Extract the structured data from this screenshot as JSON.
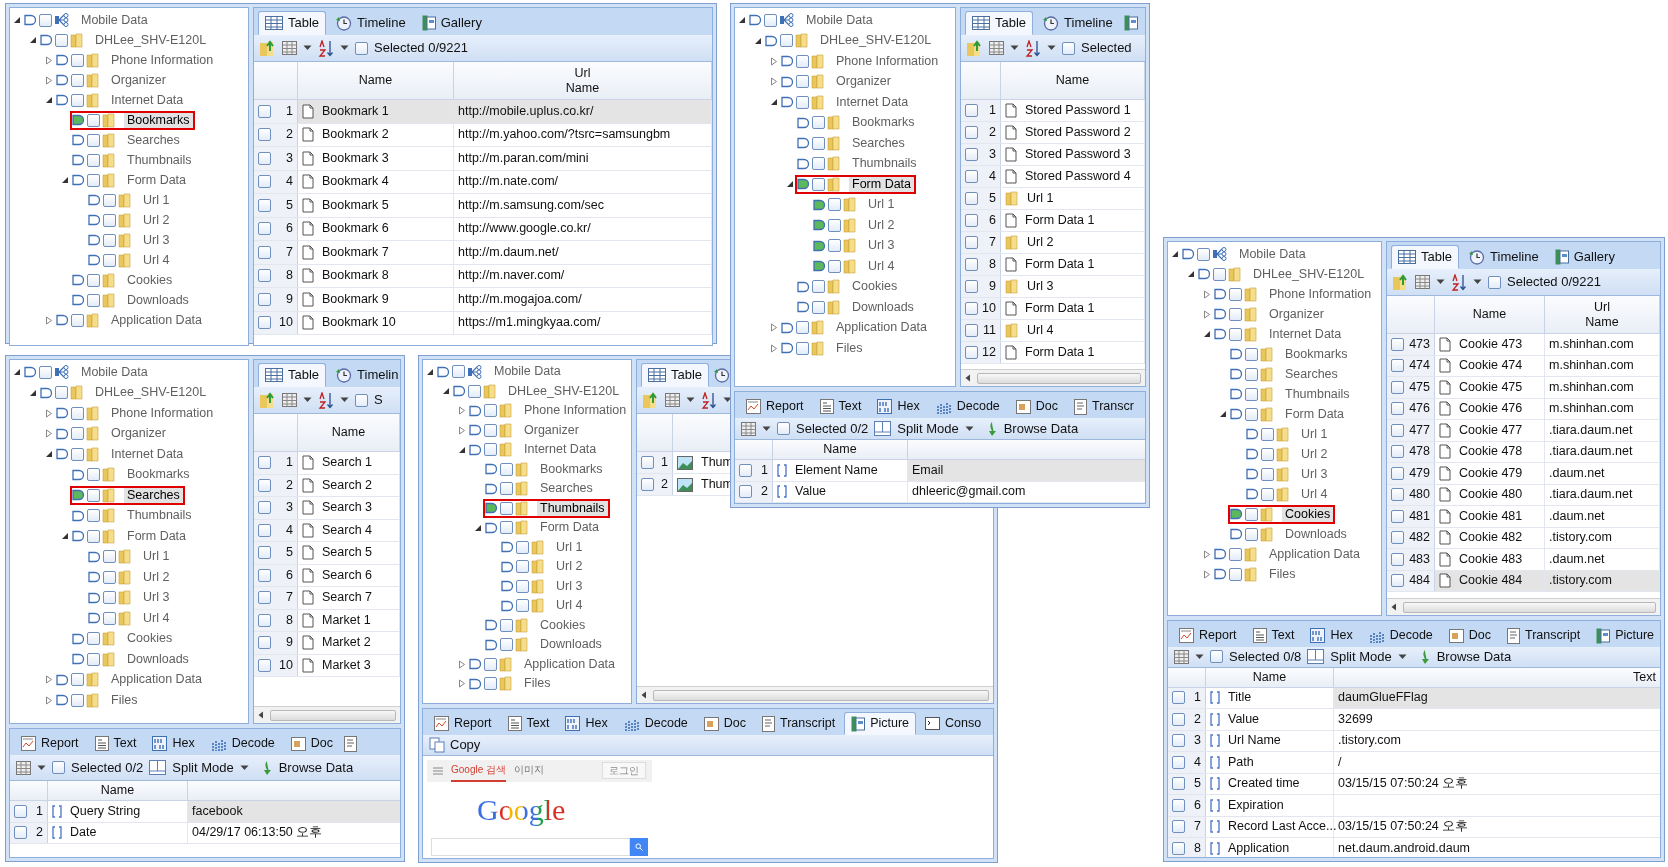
{
  "windows": [
    {
      "tree": [
        {
          "label": "Mobile Data",
          "expanded": true,
          "selected": false,
          "marked": false,
          "checked": false,
          "children": [
            {
              "label": "DHLee_SHV-E120L",
              "expanded": true,
              "selected": false,
              "marked": false,
              "checked": false,
              "children": [
                {
                  "label": "Phone Information",
                  "expanded": false,
                  "selected": false,
                  "marked": false,
                  "checked": false
                },
                {
                  "label": "Organizer",
                  "expanded": false,
                  "selected": false,
                  "marked": false,
                  "checked": false
                },
                {
                  "label": "Internet Data",
                  "expanded": true,
                  "selected": false,
                  "marked": false,
                  "checked": false,
                  "children": [
                    {
                      "label": "Bookmarks",
                      "selected": true,
                      "marked": true,
                      "checked": false
                    },
                    {
                      "label": "Searches",
                      "selected": false,
                      "marked": false,
                      "checked": false
                    },
                    {
                      "label": "Thumbnails",
                      "selected": false,
                      "marked": false,
                      "checked": false
                    },
                    {
                      "label": "Form Data",
                      "expanded": true,
                      "selected": false,
                      "marked": false,
                      "checked": false,
                      "children": [
                        {
                          "label": "Url 1",
                          "selected": false,
                          "marked": false,
                          "checked": false
                        },
                        {
                          "label": "Url 2",
                          "selected": false,
                          "marked": false,
                          "checked": false
                        },
                        {
                          "label": "Url 3",
                          "selected": false,
                          "marked": false,
                          "checked": false
                        },
                        {
                          "label": "Url 4",
                          "selected": false,
                          "marked": false,
                          "checked": false
                        }
                      ]
                    },
                    {
                      "label": "Cookies",
                      "selected": false,
                      "marked": false,
                      "checked": false
                    },
                    {
                      "label": "Downloads",
                      "selected": false,
                      "marked": false,
                      "checked": false
                    }
                  ]
                },
                {
                  "label": "Application Data",
                  "expanded": false,
                  "selected": false,
                  "marked": false,
                  "checked": false
                }
              ]
            }
          ]
        }
      ],
      "view_tabs": [
        {
          "label": "Table",
          "kind": "table",
          "selected": true
        },
        {
          "label": "Timeline",
          "kind": "timeline",
          "selected": false
        },
        {
          "label": "Gallery",
          "kind": "gallery",
          "selected": false
        }
      ],
      "toolbar": {
        "selection_count": "Selected 0/9221",
        "checked": false
      },
      "table": {
        "columns": [
          "Name",
          "Url Name"
        ],
        "rows": [
          {
            "number": "1",
            "kind": "doc",
            "cells": [
              "Bookmark 1",
              "http://mobile.uplus.co.kr/"
            ],
            "selected": true,
            "checked": false
          },
          {
            "number": "2",
            "kind": "doc",
            "cells": [
              "Bookmark 2",
              "http://m.yahoo.com/?tsrc=samsungbm"
            ],
            "selected": false,
            "checked": false
          },
          {
            "number": "3",
            "kind": "doc",
            "cells": [
              "Bookmark 3",
              "http://m.paran.com/mini"
            ],
            "selected": false,
            "checked": false
          },
          {
            "number": "4",
            "kind": "doc",
            "cells": [
              "Bookmark 4",
              "http://m.nate.com/"
            ],
            "selected": false,
            "checked": false
          },
          {
            "number": "5",
            "kind": "doc",
            "cells": [
              "Bookmark 5",
              "http://m.samsung.com/sec"
            ],
            "selected": false,
            "checked": false
          },
          {
            "number": "6",
            "kind": "doc",
            "cells": [
              "Bookmark 6",
              "http://www.google.co.kr/"
            ],
            "selected": false,
            "checked": false
          },
          {
            "number": "7",
            "kind": "doc",
            "cells": [
              "Bookmark 7",
              "http://m.daum.net/"
            ],
            "selected": false,
            "checked": false
          },
          {
            "number": "8",
            "kind": "doc",
            "cells": [
              "Bookmark 8",
              "http://m.naver.com/"
            ],
            "selected": false,
            "checked": false
          },
          {
            "number": "9",
            "kind": "doc",
            "cells": [
              "Bookmark 9",
              "http://m.mogajoa.com/"
            ],
            "selected": false,
            "checked": false
          },
          {
            "number": "10",
            "kind": "doc",
            "cells": [
              "Bookmark 10",
              "https://m1.mingkyaa.com/"
            ],
            "selected": false,
            "checked": false
          }
        ]
      }
    },
    {
      "tree": [
        {
          "label": "Mobile Data",
          "expanded": true,
          "selected": false,
          "marked": false,
          "checked": false,
          "children": [
            {
              "label": "DHLee_SHV-E120L",
              "expanded": true,
              "selected": false,
              "marked": false,
              "checked": false,
              "children": [
                {
                  "label": "Phone Information",
                  "expanded": false,
                  "selected": false,
                  "marked": false,
                  "checked": false
                },
                {
                  "label": "Organizer",
                  "expanded": false,
                  "selected": false,
                  "marked": false,
                  "checked": false
                },
                {
                  "label": "Internet Data",
                  "expanded": true,
                  "selected": false,
                  "marked": false,
                  "checked": false,
                  "children": [
                    {
                      "label": "Bookmarks",
                      "selected": false,
                      "marked": false,
                      "checked": false
                    },
                    {
                      "label": "Searches",
                      "selected": true,
                      "marked": true,
                      "checked": false
                    },
                    {
                      "label": "Thumbnails",
                      "selected": false,
                      "marked": false,
                      "checked": false
                    },
                    {
                      "label": "Form Data",
                      "expanded": true,
                      "selected": false,
                      "marked": false,
                      "checked": false,
                      "children": [
                        {
                          "label": "Url 1",
                          "selected": false,
                          "marked": false,
                          "checked": false
                        },
                        {
                          "label": "Url 2",
                          "selected": false,
                          "marked": false,
                          "checked": false
                        },
                        {
                          "label": "Url 3",
                          "selected": false,
                          "marked": false,
                          "checked": false
                        },
                        {
                          "label": "Url 4",
                          "selected": false,
                          "marked": false,
                          "checked": false
                        }
                      ]
                    },
                    {
                      "label": "Cookies",
                      "selected": false,
                      "marked": false,
                      "checked": false
                    },
                    {
                      "label": "Downloads",
                      "selected": false,
                      "marked": false,
                      "checked": false
                    }
                  ]
                },
                {
                  "label": "Application Data",
                  "expanded": false,
                  "selected": false,
                  "marked": false,
                  "checked": false
                },
                {
                  "label": "Files",
                  "expanded": false,
                  "selected": false,
                  "marked": false,
                  "checked": false
                }
              ]
            }
          ]
        }
      ],
      "view_tabs": [
        {
          "label": "Table",
          "kind": "table",
          "selected": true
        },
        {
          "label": "Timelin",
          "kind": "timeline",
          "selected": false
        }
      ],
      "toolbar": {
        "selection_count": "S",
        "checked": false
      },
      "table": {
        "columns": [
          "Name"
        ],
        "rows": [
          {
            "number": "1",
            "kind": "doc",
            "cells": [
              "Search 1"
            ],
            "selected": false,
            "checked": false
          },
          {
            "number": "2",
            "kind": "doc",
            "cells": [
              "Search 2"
            ],
            "selected": false,
            "checked": false
          },
          {
            "number": "3",
            "kind": "doc",
            "cells": [
              "Search 3"
            ],
            "selected": false,
            "checked": false
          },
          {
            "number": "4",
            "kind": "doc",
            "cells": [
              "Search 4"
            ],
            "selected": false,
            "checked": false
          },
          {
            "number": "5",
            "kind": "doc",
            "cells": [
              "Search 5"
            ],
            "selected": false,
            "checked": false
          },
          {
            "number": "6",
            "kind": "doc",
            "cells": [
              "Search 6"
            ],
            "selected": false,
            "checked": false
          },
          {
            "number": "7",
            "kind": "doc",
            "cells": [
              "Search 7"
            ],
            "selected": false,
            "checked": false
          },
          {
            "number": "8",
            "kind": "doc",
            "cells": [
              "Market 1"
            ],
            "selected": false,
            "checked": false
          },
          {
            "number": "9",
            "kind": "doc",
            "cells": [
              "Market 2"
            ],
            "selected": false,
            "checked": false
          },
          {
            "number": "10",
            "kind": "doc",
            "cells": [
              "Market 3"
            ],
            "selected": false,
            "checked": false
          }
        ]
      },
      "detail": {
        "tabs": [
          {
            "label": "Report",
            "kind": "report",
            "selected": false
          },
          {
            "label": "Text",
            "kind": "text",
            "selected": false
          },
          {
            "label": "Hex",
            "kind": "hex",
            "selected": false
          },
          {
            "label": "Decode",
            "kind": "decode",
            "selected": false
          },
          {
            "label": "Doc",
            "kind": "doc",
            "selected": false
          },
          {
            "kind": "transcript",
            "selected": false
          }
        ],
        "toolbar": {
          "selection_count": "Selected 0/2",
          "checked": false,
          "split": "Split Mode",
          "browse": "Browse Data"
        },
        "columns": [
          "Name"
        ],
        "rows": [
          {
            "number": "1",
            "name": "Query String",
            "value": "facebook",
            "selected": true,
            "checked": false
          },
          {
            "number": "2",
            "name": "Date",
            "value": "04/29/17 06:13:50 오후",
            "selected": false,
            "checked": false
          }
        ]
      }
    },
    {
      "tree": [
        {
          "label": "Mobile Data",
          "expanded": true,
          "selected": false,
          "marked": false,
          "checked": false,
          "children": [
            {
              "label": "DHLee_SHV-E120L",
              "expanded": true,
              "selected": false,
              "marked": false,
              "checked": false,
              "children": [
                {
                  "label": "Phone Information",
                  "expanded": false,
                  "selected": false,
                  "marked": false,
                  "checked": false
                },
                {
                  "label": "Organizer",
                  "expanded": false,
                  "selected": false,
                  "marked": false,
                  "checked": false
                },
                {
                  "label": "Internet Data",
                  "expanded": true,
                  "selected": false,
                  "marked": false,
                  "checked": false,
                  "children": [
                    {
                      "label": "Bookmarks",
                      "selected": false,
                      "marked": false,
                      "checked": false
                    },
                    {
                      "label": "Searches",
                      "selected": false,
                      "marked": false,
                      "checked": false
                    },
                    {
                      "label": "Thumbnails",
                      "selected": true,
                      "marked": true,
                      "checked": false
                    },
                    {
                      "label": "Form Data",
                      "expanded": true,
                      "selected": false,
                      "marked": false,
                      "checked": false,
                      "children": [
                        {
                          "label": "Url 1",
                          "selected": false,
                          "marked": false,
                          "checked": false
                        },
                        {
                          "label": "Url 2",
                          "selected": false,
                          "marked": false,
                          "checked": false
                        },
                        {
                          "label": "Url 3",
                          "selected": false,
                          "marked": false,
                          "checked": false
                        },
                        {
                          "label": "Url 4",
                          "selected": false,
                          "marked": false,
                          "checked": false
                        }
                      ]
                    },
                    {
                      "label": "Cookies",
                      "selected": false,
                      "marked": false,
                      "checked": false
                    },
                    {
                      "label": "Downloads",
                      "selected": false,
                      "marked": false,
                      "checked": false
                    }
                  ]
                },
                {
                  "label": "Application Data",
                  "expanded": false,
                  "selected": false,
                  "marked": false,
                  "checked": false
                },
                {
                  "label": "Files",
                  "expanded": false,
                  "selected": false,
                  "marked": false,
                  "checked": false
                }
              ]
            }
          ]
        }
      ],
      "view_tabs": [
        {
          "label": "Table",
          "kind": "table",
          "selected": true
        },
        {
          "kind": "timeline",
          "selected": false
        }
      ],
      "table": {
        "rows": [
          {
            "number": "1",
            "kind": "image",
            "cells": [
              "Thum"
            ],
            "selected": false,
            "checked": false
          },
          {
            "number": "2",
            "kind": "image",
            "cells": [
              "Thum"
            ],
            "selected": false,
            "checked": false
          }
        ]
      },
      "detail": {
        "tabs": [
          {
            "label": "Report",
            "kind": "report",
            "selected": false
          },
          {
            "label": "Text",
            "kind": "text",
            "selected": false
          },
          {
            "label": "Hex",
            "kind": "hex",
            "selected": false
          },
          {
            "label": "Decode",
            "kind": "decode",
            "selected": false
          },
          {
            "label": "Doc",
            "kind": "doc",
            "selected": false
          },
          {
            "label": "Transcript",
            "kind": "transcript",
            "selected": false
          },
          {
            "label": "Picture",
            "kind": "picture",
            "selected": true
          },
          {
            "label": "Conso",
            "kind": "console",
            "selected": false
          }
        ],
        "copy": "Copy",
        "thumbnail": {
          "tabs": [
            {
              "label": "Google 검색",
              "selected": true
            },
            {
              "label": "이미지",
              "selected": false
            }
          ],
          "login": "로그인",
          "logo": "Google"
        }
      }
    },
    {
      "tree": [
        {
          "label": "Mobile Data",
          "expanded": true,
          "selected": false,
          "marked": false,
          "checked": false,
          "children": [
            {
              "label": "DHLee_SHV-E120L",
              "expanded": true,
              "selected": false,
              "marked": false,
              "checked": false,
              "children": [
                {
                  "label": "Phone Information",
                  "expanded": false,
                  "selected": false,
                  "marked": false,
                  "checked": false
                },
                {
                  "label": "Organizer",
                  "expanded": false,
                  "selected": false,
                  "marked": false,
                  "checked": false
                },
                {
                  "label": "Internet Data",
                  "expanded": true,
                  "selected": false,
                  "marked": false,
                  "checked": false,
                  "children": [
                    {
                      "label": "Bookmarks",
                      "selected": false,
                      "marked": false,
                      "checked": false
                    },
                    {
                      "label": "Searches",
                      "selected": false,
                      "marked": false,
                      "checked": false
                    },
                    {
                      "label": "Thumbnails",
                      "selected": false,
                      "marked": false,
                      "checked": false
                    },
                    {
                      "label": "Form Data",
                      "expanded": true,
                      "selected": true,
                      "marked": true,
                      "checked": false,
                      "children": [
                        {
                          "label": "Url 1",
                          "selected": false,
                          "marked": true,
                          "checked": false
                        },
                        {
                          "label": "Url 2",
                          "selected": false,
                          "marked": true,
                          "checked": false
                        },
                        {
                          "label": "Url 3",
                          "selected": false,
                          "marked": true,
                          "checked": false
                        },
                        {
                          "label": "Url 4",
                          "selected": false,
                          "marked": true,
                          "checked": false
                        }
                      ]
                    },
                    {
                      "label": "Cookies",
                      "selected": false,
                      "marked": false,
                      "checked": false
                    },
                    {
                      "label": "Downloads",
                      "selected": false,
                      "marked": false,
                      "checked": false
                    }
                  ]
                },
                {
                  "label": "Application Data",
                  "expanded": false,
                  "selected": false,
                  "marked": false,
                  "checked": false
                },
                {
                  "label": "Files",
                  "expanded": false,
                  "selected": false,
                  "marked": false,
                  "checked": false
                }
              ]
            }
          ]
        }
      ],
      "view_tabs": [
        {
          "label": "Table",
          "kind": "table",
          "selected": true
        },
        {
          "label": "Timeline",
          "kind": "timeline",
          "selected": false
        },
        {
          "kind": "gallery",
          "selected": false
        }
      ],
      "toolbar": {
        "selection_count": "Selected",
        "checked": false
      },
      "table": {
        "columns": [
          "Name"
        ],
        "rows": [
          {
            "number": "1",
            "kind": "doc",
            "cells": [
              "Stored Password 1"
            ],
            "selected": false,
            "checked": false
          },
          {
            "number": "2",
            "kind": "doc",
            "cells": [
              "Stored Password 2"
            ],
            "selected": false,
            "checked": false
          },
          {
            "number": "3",
            "kind": "doc",
            "cells": [
              "Stored Password 3"
            ],
            "selected": false,
            "checked": false
          },
          {
            "number": "4",
            "kind": "doc",
            "cells": [
              "Stored Password 4"
            ],
            "selected": false,
            "checked": false
          },
          {
            "number": "5",
            "kind": "folder",
            "cells": [
              "Url 1"
            ],
            "selected": false,
            "checked": false
          },
          {
            "number": "6",
            "kind": "doc",
            "cells": [
              "Form Data 1"
            ],
            "selected": false,
            "checked": false
          },
          {
            "number": "7",
            "kind": "folder",
            "cells": [
              "Url 2"
            ],
            "selected": false,
            "checked": false
          },
          {
            "number": "8",
            "kind": "doc",
            "cells": [
              "Form Data 1"
            ],
            "selected": false,
            "checked": false
          },
          {
            "number": "9",
            "kind": "folder",
            "cells": [
              "Url 3"
            ],
            "selected": false,
            "checked": false
          },
          {
            "number": "10",
            "kind": "doc",
            "cells": [
              "Form Data 1"
            ],
            "selected": false,
            "checked": false
          },
          {
            "number": "11",
            "kind": "folder",
            "cells": [
              "Url 4"
            ],
            "selected": false,
            "checked": false
          },
          {
            "number": "12",
            "kind": "doc",
            "cells": [
              "Form Data 1"
            ],
            "selected": false,
            "checked": false
          }
        ]
      },
      "detail": {
        "tabs": [
          {
            "label": "Report",
            "kind": "report",
            "selected": false
          },
          {
            "label": "Text",
            "kind": "text",
            "selected": false
          },
          {
            "label": "Hex",
            "kind": "hex",
            "selected": false
          },
          {
            "label": "Decode",
            "kind": "decode",
            "selected": false
          },
          {
            "label": "Doc",
            "kind": "doc",
            "selected": false
          },
          {
            "label": "Transcr",
            "kind": "transcript",
            "selected": false
          }
        ],
        "toolbar": {
          "selection_count": "Selected 0/2",
          "checked": false,
          "split": "Split Mode",
          "browse": "Browse Data"
        },
        "columns": [
          "Name"
        ],
        "rows": [
          {
            "number": "1",
            "name": "Element Name",
            "value": "Email",
            "selected": true,
            "checked": false
          },
          {
            "number": "2",
            "name": "Value",
            "value": "dhleeric@gmail.com",
            "selected": false,
            "checked": false
          }
        ]
      }
    },
    {
      "tree": [
        {
          "label": "Mobile Data",
          "expanded": true,
          "selected": false,
          "marked": false,
          "checked": false,
          "children": [
            {
              "label": "DHLee_SHV-E120L",
              "expanded": true,
              "selected": false,
              "marked": false,
              "checked": false,
              "children": [
                {
                  "label": "Phone Information",
                  "expanded": false,
                  "selected": false,
                  "marked": false,
                  "checked": false
                },
                {
                  "label": "Organizer",
                  "expanded": false,
                  "selected": false,
                  "marked": false,
                  "checked": false
                },
                {
                  "label": "Internet Data",
                  "expanded": true,
                  "selected": false,
                  "marked": false,
                  "checked": false,
                  "children": [
                    {
                      "label": "Bookmarks",
                      "selected": false,
                      "marked": false,
                      "checked": false
                    },
                    {
                      "label": "Searches",
                      "selected": false,
                      "marked": false,
                      "checked": false
                    },
                    {
                      "label": "Thumbnails",
                      "selected": false,
                      "marked": false,
                      "checked": false
                    },
                    {
                      "label": "Form Data",
                      "expanded": true,
                      "selected": false,
                      "marked": false,
                      "checked": false,
                      "children": [
                        {
                          "label": "Url 1",
                          "selected": false,
                          "marked": false,
                          "checked": false
                        },
                        {
                          "label": "Url 2",
                          "selected": false,
                          "marked": false,
                          "checked": false
                        },
                        {
                          "label": "Url 3",
                          "selected": false,
                          "marked": false,
                          "checked": false
                        },
                        {
                          "label": "Url 4",
                          "selected": false,
                          "marked": false,
                          "checked": false
                        }
                      ]
                    },
                    {
                      "label": "Cookies",
                      "selected": true,
                      "marked": true,
                      "checked": false
                    },
                    {
                      "label": "Downloads",
                      "selected": false,
                      "marked": false,
                      "checked": false
                    }
                  ]
                },
                {
                  "label": "Application Data",
                  "expanded": false,
                  "selected": false,
                  "marked": false,
                  "checked": false
                },
                {
                  "label": "Files",
                  "expanded": false,
                  "selected": false,
                  "marked": false,
                  "checked": false
                }
              ]
            }
          ]
        }
      ],
      "view_tabs": [
        {
          "label": "Table",
          "kind": "table",
          "selected": true
        },
        {
          "label": "Timeline",
          "kind": "timeline",
          "selected": false
        },
        {
          "label": "Gallery",
          "kind": "gallery",
          "selected": false
        }
      ],
      "toolbar": {
        "selection_count": "Selected 0/9221",
        "checked": false
      },
      "table": {
        "columns": [
          "Name",
          "Url Name"
        ],
        "rows": [
          {
            "number": "473",
            "kind": "doc",
            "cells": [
              "Cookie 473",
              "m.shinhan.com"
            ],
            "selected": false,
            "checked": false
          },
          {
            "number": "474",
            "kind": "doc",
            "cells": [
              "Cookie 474",
              "m.shinhan.com"
            ],
            "selected": false,
            "checked": false
          },
          {
            "number": "475",
            "kind": "doc",
            "cells": [
              "Cookie 475",
              "m.shinhan.com"
            ],
            "selected": false,
            "checked": false
          },
          {
            "number": "476",
            "kind": "doc",
            "cells": [
              "Cookie 476",
              "m.shinhan.com"
            ],
            "selected": false,
            "checked": false
          },
          {
            "number": "477",
            "kind": "doc",
            "cells": [
              "Cookie 477",
              ".tiara.daum.net"
            ],
            "selected": false,
            "checked": false
          },
          {
            "number": "478",
            "kind": "doc",
            "cells": [
              "Cookie 478",
              ".tiara.daum.net"
            ],
            "selected": false,
            "checked": false
          },
          {
            "number": "479",
            "kind": "doc",
            "cells": [
              "Cookie 479",
              ".daum.net"
            ],
            "selected": false,
            "checked": false
          },
          {
            "number": "480",
            "kind": "doc",
            "cells": [
              "Cookie 480",
              ".tiara.daum.net"
            ],
            "selected": false,
            "checked": false
          },
          {
            "number": "481",
            "kind": "doc",
            "cells": [
              "Cookie 481",
              ".daum.net"
            ],
            "selected": false,
            "checked": false
          },
          {
            "number": "482",
            "kind": "doc",
            "cells": [
              "Cookie 482",
              ".tistory.com"
            ],
            "selected": false,
            "checked": false
          },
          {
            "number": "483",
            "kind": "doc",
            "cells": [
              "Cookie 483",
              ".daum.net"
            ],
            "selected": false,
            "checked": false
          },
          {
            "number": "484",
            "kind": "doc",
            "cells": [
              "Cookie 484",
              ".tistory.com"
            ],
            "selected": true,
            "checked": false
          }
        ]
      },
      "detail": {
        "tabs": [
          {
            "label": "Report",
            "kind": "report",
            "selected": false
          },
          {
            "label": "Text",
            "kind": "text",
            "selected": false
          },
          {
            "label": "Hex",
            "kind": "hex",
            "selected": false
          },
          {
            "label": "Decode",
            "kind": "decode",
            "selected": false
          },
          {
            "label": "Doc",
            "kind": "doc",
            "selected": false
          },
          {
            "label": "Transcript",
            "kind": "transcript",
            "selected": false
          },
          {
            "label": "Picture",
            "kind": "picture",
            "selected": false
          }
        ],
        "toolbar": {
          "selection_count": "Selected 0/8",
          "checked": false,
          "split": "Split Mode",
          "browse": "Browse Data"
        },
        "columns": [
          "Name",
          "Text"
        ],
        "rows": [
          {
            "number": "1",
            "name": "Title",
            "value": "daumGlueFFlag",
            "selected": true,
            "checked": false
          },
          {
            "number": "2",
            "name": "Value",
            "value": "32699",
            "selected": false,
            "checked": false
          },
          {
            "number": "3",
            "name": "Url Name",
            "value": ".tistory.com",
            "selected": false,
            "checked": false
          },
          {
            "number": "4",
            "name": "Path",
            "value": "/",
            "selected": false,
            "checked": false
          },
          {
            "number": "5",
            "name": "Created time",
            "value": "03/15/15 07:50:24 오후",
            "selected": false,
            "checked": false
          },
          {
            "number": "6",
            "name": "Expiration",
            "selected": false,
            "checked": false
          },
          {
            "number": "7",
            "name": "Record Last Acce...",
            "value": "03/15/15 07:50:24 오후",
            "selected": false,
            "checked": false
          },
          {
            "number": "8",
            "name": "Application",
            "value": "net.daum.android.daum",
            "selected": false,
            "checked": false
          }
        ]
      }
    }
  ]
}
